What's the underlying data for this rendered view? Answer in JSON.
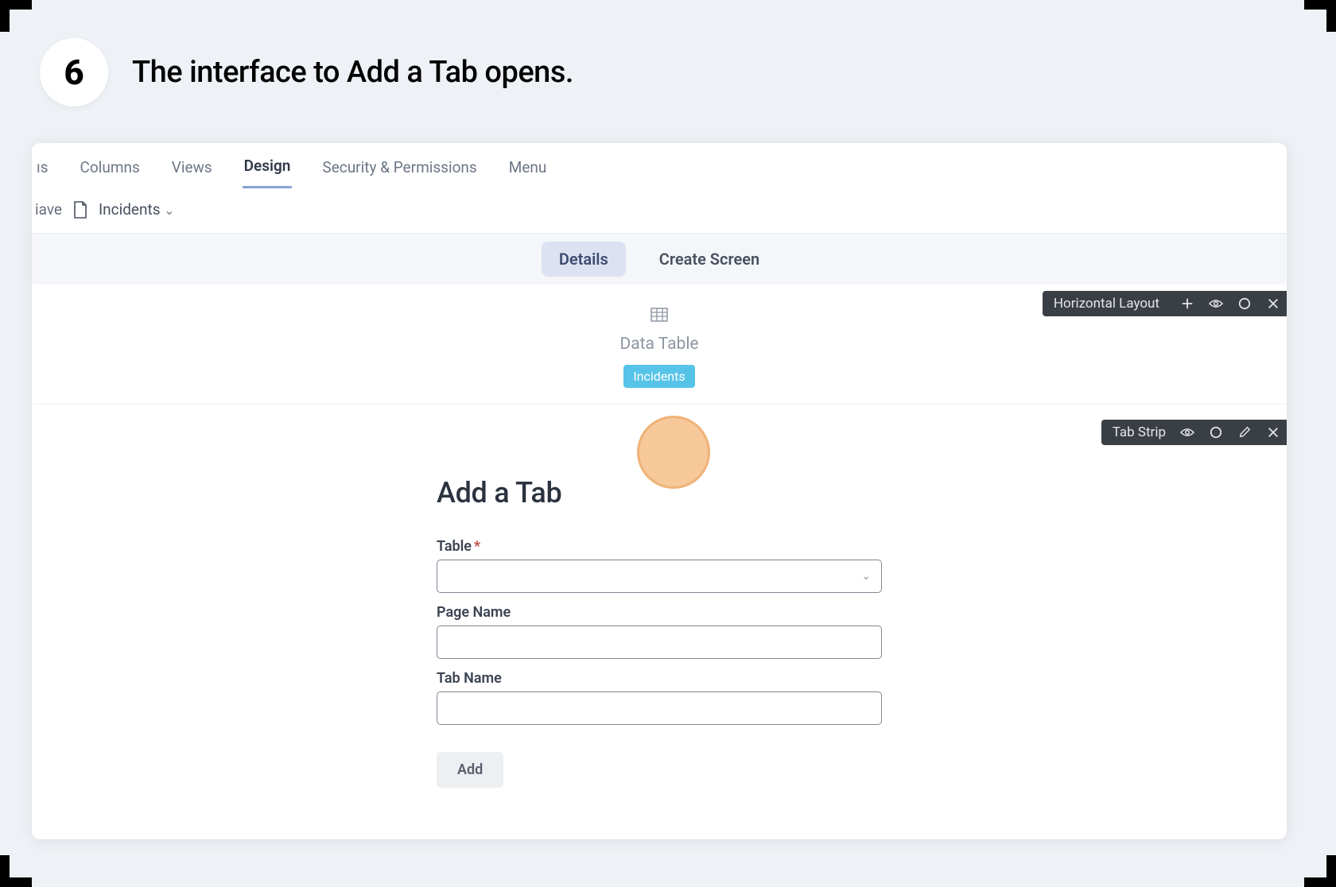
{
  "step": {
    "number": "6",
    "text": "The interface to Add a Tab opens."
  },
  "topNav": {
    "partial": "ıs",
    "items": [
      "Columns",
      "Views",
      "Design",
      "Security & Permissions",
      "Menu"
    ],
    "activeIndex": 2
  },
  "secondaryBar": {
    "savePartial": "iave",
    "page": "Incidents"
  },
  "subTabs": {
    "items": [
      "Details",
      "Create Screen"
    ],
    "activeIndex": 0
  },
  "overlays": {
    "horizontal": "Horizontal Layout",
    "tabStrip": "Tab Strip"
  },
  "dataTable": {
    "label": "Data Table",
    "chip": "Incidents"
  },
  "form": {
    "title": "Add a Tab",
    "fields": {
      "table": {
        "label": "Table",
        "required": "*",
        "value": ""
      },
      "pageName": {
        "label": "Page Name",
        "value": ""
      },
      "tabName": {
        "label": "Tab Name",
        "value": ""
      }
    },
    "submit": "Add"
  }
}
